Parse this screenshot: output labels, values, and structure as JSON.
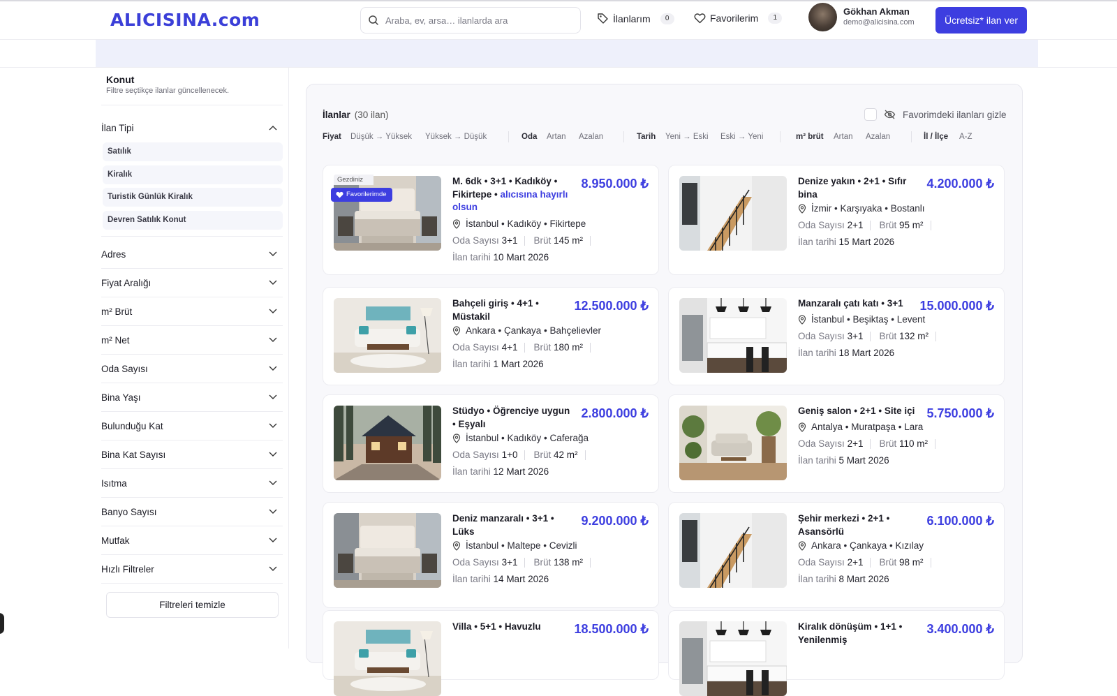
{
  "header": {
    "logo": "ALICISINA.com",
    "search_placeholder": "Araba, ev, arsa… ilanlarda ara",
    "my_listings_label": "İlanlarım",
    "my_listings_count": "0",
    "favorites_label": "Favorilerim",
    "favorites_count": "1",
    "user_name": "Gökhan Akman",
    "user_email": "demo@alicisina.com",
    "cta_label": "Ücretsiz* ilan ver"
  },
  "sidebar": {
    "title": "Konut",
    "subtitle": "Filtre seçtikçe ilanlar güncellenecek.",
    "ilan_tipi": {
      "label": "İlan Tipi",
      "options": [
        "Satılık",
        "Kiralık",
        "Turistik Günlük Kiralık",
        "Devren Satılık Konut"
      ]
    },
    "sections": [
      "Adres",
      "Fiyat Aralığı",
      "m² Brüt",
      "m² Net",
      "Oda Sayısı",
      "Bina Yaşı",
      "Bulunduğu Kat",
      "Bina Kat Sayısı",
      "Isıtma",
      "Banyo Sayısı",
      "Mutfak",
      "Hızlı Filtreler"
    ],
    "clear_label": "Filtreleri temizle"
  },
  "listings": {
    "title": "İlanlar",
    "count": "(30 ilan)",
    "hide_favs_label": "Favorimdeki ilanları gizle",
    "sort": {
      "fiyat": {
        "label": "Fiyat",
        "asc": "Düşük → Yüksek",
        "desc": "Yüksek → Düşük"
      },
      "oda": {
        "label": "Oda",
        "asc": "Artan",
        "desc": "Azalan"
      },
      "tarih": {
        "label": "Tarih",
        "asc": "Yeni → Eski",
        "desc": "Eski → Yeni"
      },
      "m2": {
        "label": "m² brüt",
        "asc": "Artan",
        "desc": "Azalan"
      },
      "ilce": {
        "label": "İl / İlçe",
        "asc": "A-Z"
      }
    },
    "room_label": "Oda Sayısı",
    "gross_label": "Brüt",
    "date_label": "İlan tarihi",
    "visited_tag": "Gezdiniz",
    "fav_tag": "Favorilerimde",
    "cards": [
      {
        "title": "M. 6dk • 3+1 • Kadıköy • Fikirtepe •",
        "title_hl": "alıcısına hayırlı olsun",
        "price": "8.950.000 ₺",
        "location": "İstanbul • Kadıköy • Fikirtepe",
        "rooms": "3+1",
        "gross": "145 m²",
        "date": "10 Mart 2026",
        "image": "bedroom"
      },
      {
        "title": "Denize yakın • 2+1 • Sıfır bina",
        "title_hl": "",
        "price": "4.200.000 ₺",
        "location": "İzmir • Karşıyaka • Bostanlı",
        "rooms": "2+1",
        "gross": "95 m²",
        "date": "15 Mart 2026",
        "image": "stairs"
      },
      {
        "title": "Bahçeli giriş • 4+1 • Müstakil",
        "title_hl": "",
        "price": "12.500.000 ₺",
        "location": "Ankara • Çankaya • Bahçelievler",
        "rooms": "4+1",
        "gross": "180 m²",
        "date": "1 Mart 2026",
        "image": "living"
      },
      {
        "title": "Manzaralı çatı katı • 3+1",
        "title_hl": "",
        "price": "15.000.000 ₺",
        "location": "İstanbul • Beşiktaş • Levent",
        "rooms": "3+1",
        "gross": "132 m²",
        "date": "18 Mart 2026",
        "image": "kitchen"
      },
      {
        "title": "Stüdyo • Öğrenciye uygun • Eşyalı",
        "title_hl": "",
        "price": "2.800.000 ₺",
        "location": "İstanbul • Kadıköy • Caferağa",
        "rooms": "1+0",
        "gross": "42 m²",
        "date": "12 Mart 2026",
        "image": "house"
      },
      {
        "title": "Geniş salon • 2+1 • Site içi",
        "title_hl": "",
        "price": "5.750.000 ₺",
        "location": "Antalya • Muratpaşa • Lara",
        "rooms": "2+1",
        "gross": "110 m²",
        "date": "5 Mart 2026",
        "image": "salon"
      },
      {
        "title": "Deniz manzaralı • 3+1 • Lüks",
        "title_hl": "",
        "price": "9.200.000 ₺",
        "location": "İstanbul • Maltepe • Cevizli",
        "rooms": "3+1",
        "gross": "138 m²",
        "date": "14 Mart 2026",
        "image": "bedroom"
      },
      {
        "title": "Şehir merkezi • 2+1 • Asansörlü",
        "title_hl": "",
        "price": "6.100.000 ₺",
        "location": "Ankara • Çankaya • Kızılay",
        "rooms": "2+1",
        "gross": "98 m²",
        "date": "8 Mart 2026",
        "image": "stairs"
      },
      {
        "title": "Villa • 5+1 • Havuzlu",
        "title_hl": "",
        "price": "18.500.000 ₺",
        "location": "",
        "rooms": "",
        "gross": "",
        "date": "",
        "image": "living"
      },
      {
        "title": "Kiralık dönüşüm • 1+1 • Yenilenmiş",
        "title_hl": "",
        "price": "3.400.000 ₺",
        "location": "",
        "rooms": "",
        "gross": "",
        "date": "",
        "image": "kitchen"
      }
    ]
  },
  "colors": {
    "accent": "#3d3ee0",
    "banner": "#eef0fb",
    "panel": "#f8f8fb"
  }
}
